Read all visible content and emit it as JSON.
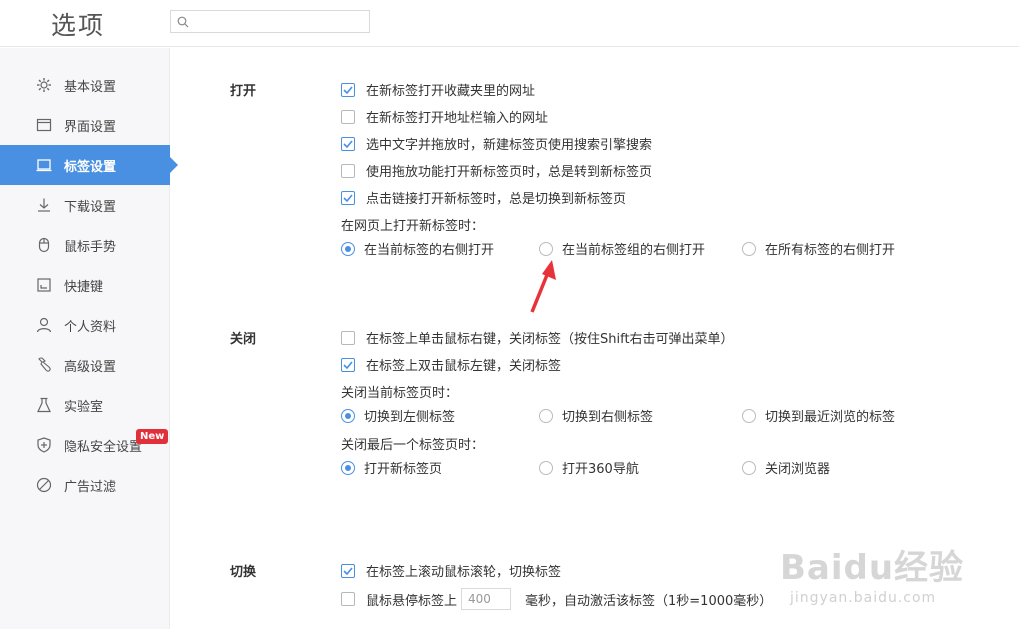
{
  "header": {
    "title": "选项",
    "search_placeholder": ""
  },
  "sidebar": {
    "items": [
      {
        "label": "基本设置",
        "icon": "gear-icon"
      },
      {
        "label": "界面设置",
        "icon": "window-icon"
      },
      {
        "label": "标签设置",
        "icon": "tab-icon",
        "active": true
      },
      {
        "label": "下载设置",
        "icon": "download-icon"
      },
      {
        "label": "鼠标手势",
        "icon": "mouse-icon"
      },
      {
        "label": "快捷键",
        "icon": "shortcut-icon"
      },
      {
        "label": "个人资料",
        "icon": "user-icon"
      },
      {
        "label": "高级设置",
        "icon": "wrench-icon"
      },
      {
        "label": "实验室",
        "icon": "flask-icon"
      },
      {
        "label": "隐私安全设置",
        "icon": "shield-icon",
        "badge": "New"
      },
      {
        "label": "广告过滤",
        "icon": "block-icon"
      }
    ],
    "accent_color": "#4a90e2"
  },
  "open": {
    "label": "打开",
    "options": [
      {
        "label": "在新标签打开收藏夹里的网址",
        "checked": true
      },
      {
        "label": "在新标签打开地址栏输入的网址",
        "checked": false
      },
      {
        "label": "选中文字并拖放时，新建标签页使用搜索引擎搜索",
        "checked": true
      },
      {
        "label": "使用拖放功能打开新标签页时，总是转到新标签页",
        "checked": false
      },
      {
        "label": "点击链接打开新标签时，总是切换到新标签页",
        "checked": true
      }
    ],
    "position_label": "在网页上打开新标签时：",
    "position_options": [
      {
        "label": "在当前标签的右侧打开",
        "checked": true
      },
      {
        "label": "在当前标签组的右侧打开",
        "checked": false
      },
      {
        "label": "在所有标签的右侧打开",
        "checked": false
      }
    ]
  },
  "close": {
    "label": "关闭",
    "options": [
      {
        "label": "在标签上单击鼠标右键，关闭标签（按住Shift右击可弹出菜单）",
        "checked": false
      },
      {
        "label": "在标签上双击鼠标左键，关闭标签",
        "checked": true
      }
    ],
    "current_label": "关闭当前标签页时：",
    "current_options": [
      {
        "label": "切换到左侧标签",
        "checked": true
      },
      {
        "label": "切换到右侧标签",
        "checked": false
      },
      {
        "label": "切换到最近浏览的标签",
        "checked": false
      }
    ],
    "last_label": "关闭最后一个标签页时：",
    "last_options": [
      {
        "label": "打开新标签页",
        "checked": true
      },
      {
        "label": "打开360导航",
        "checked": false
      },
      {
        "label": "关闭浏览器",
        "checked": false
      }
    ]
  },
  "switch": {
    "label": "切换",
    "options": [
      {
        "label": "在标签上滚动鼠标滚轮，切换标签",
        "checked": true
      }
    ],
    "hover_label_before": "鼠标悬停标签上",
    "hover_value": "400",
    "hover_label_after": "毫秒，自动激活该标签（1秒=1000毫秒）",
    "hover_checked": false
  },
  "watermark": {
    "text": "Baidu经验",
    "sub": "jingyan.baidu.com"
  }
}
